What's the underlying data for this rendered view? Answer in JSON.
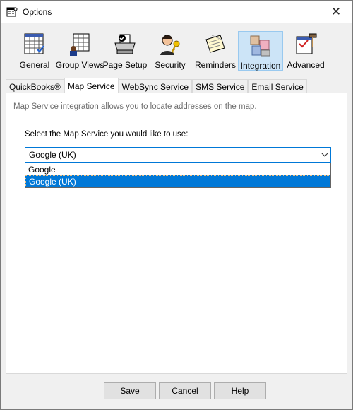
{
  "window": {
    "title": "Options"
  },
  "toolbar": {
    "items": [
      {
        "label": "General",
        "icon": "calendar-grid-icon"
      },
      {
        "label": "Group Views",
        "icon": "grouped-calendar-icon"
      },
      {
        "label": "Page Setup",
        "icon": "printer-icon"
      },
      {
        "label": "Security",
        "icon": "user-key-icon"
      },
      {
        "label": "Reminders",
        "icon": "sticky-notes-icon"
      },
      {
        "label": "Integration",
        "icon": "puzzle-blocks-icon"
      },
      {
        "label": "Advanced",
        "icon": "hammer-calendar-icon"
      }
    ],
    "active_index": 5
  },
  "tabs": {
    "items": [
      "QuickBooks®",
      "Map Service",
      "WebSync Service",
      "SMS Service",
      "Email Service"
    ],
    "active_index": 1
  },
  "panel": {
    "info": "Map Service integration allows you to locate addresses on the map.",
    "prompt": "Select the Map Service you would like to use:",
    "combo": {
      "value": "Google (UK)",
      "options": [
        "Google",
        "Google (UK)"
      ],
      "highlighted": "Google (UK)"
    }
  },
  "footer": {
    "save": "Save",
    "cancel": "Cancel",
    "help": "Help"
  },
  "colors": {
    "accent": "#0078d7",
    "active_tool_bg": "#cce4f7",
    "window_bg": "#f0f0f0"
  }
}
